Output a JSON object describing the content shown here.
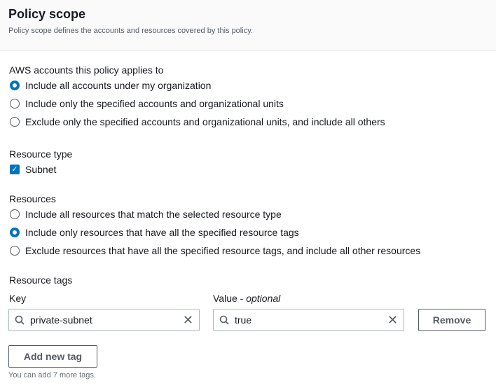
{
  "header": {
    "title": "Policy scope",
    "description": "Policy scope defines the accounts and resources covered by this policy."
  },
  "accounts": {
    "label": "AWS accounts this policy applies to",
    "options": [
      {
        "label": "Include all accounts under my organization",
        "selected": true
      },
      {
        "label": "Include only the specified accounts and organizational units",
        "selected": false
      },
      {
        "label": "Exclude only the specified accounts and organizational units, and include all others",
        "selected": false
      }
    ]
  },
  "resource_type": {
    "label": "Resource type",
    "options": [
      {
        "label": "Subnet",
        "checked": true
      }
    ]
  },
  "resources": {
    "label": "Resources",
    "options": [
      {
        "label": "Include all resources that match the selected resource type",
        "selected": false
      },
      {
        "label": "Include only resources that have all the specified resource tags",
        "selected": true
      },
      {
        "label": "Exclude resources that have all the specified resource tags, and include all other resources",
        "selected": false
      }
    ]
  },
  "tags": {
    "label": "Resource tags",
    "key_label": "Key",
    "value_label": "Value - ",
    "value_optional": "optional",
    "key_value": "private-subnet",
    "value_value": "true",
    "remove_label": "Remove",
    "add_label": "Add new tag",
    "hint": "You can add 7 more tags."
  }
}
